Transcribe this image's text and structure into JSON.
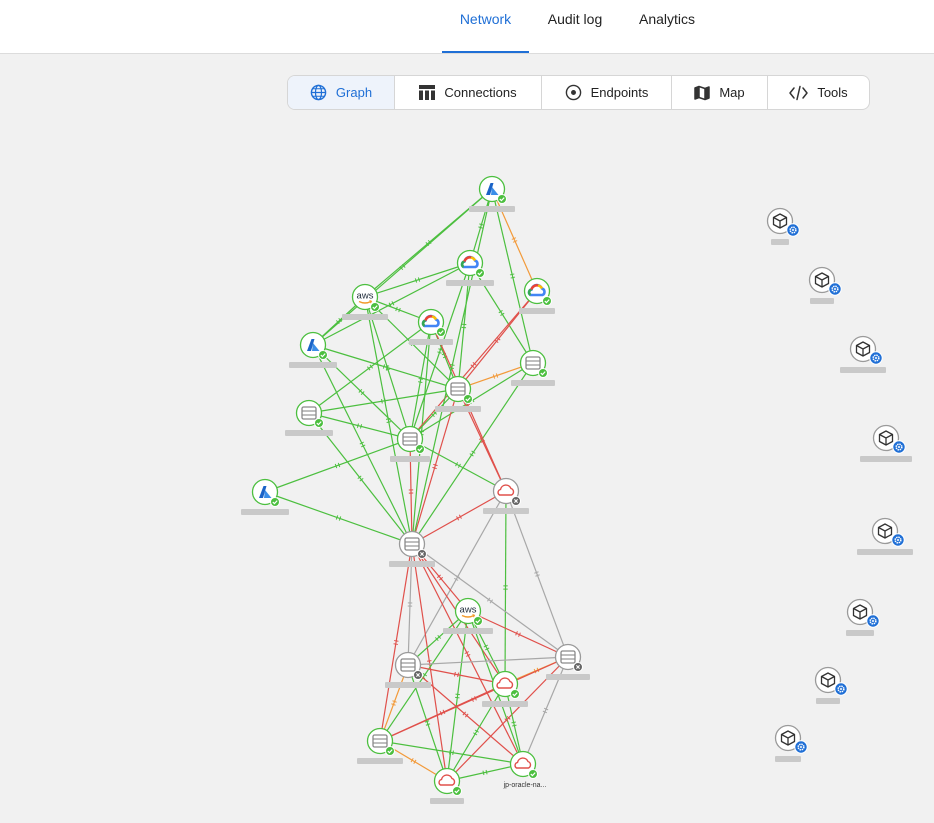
{
  "top_tabs": [
    {
      "label": "Network",
      "active": true
    },
    {
      "label": "Audit log",
      "active": false
    },
    {
      "label": "Analytics",
      "active": false
    }
  ],
  "toolbar": [
    {
      "label": "Graph",
      "icon": "globe-icon",
      "active": true
    },
    {
      "label": "Connections",
      "icon": "table-icon",
      "active": false
    },
    {
      "label": "Endpoints",
      "icon": "target-icon",
      "active": false
    },
    {
      "label": "Map",
      "icon": "map-icon",
      "active": false
    },
    {
      "label": "Tools",
      "icon": "code-icon",
      "active": false
    }
  ],
  "graph": {
    "visible_node_labels": [
      "jp-oracle-na..."
    ],
    "colors": {
      "ok_edge": "#4cbf3f",
      "error_edge": "#e0504b",
      "warn_edge": "#f29a3a",
      "inactive_edge": "#a8a8a8",
      "accent": "#1f6fd6"
    }
  }
}
